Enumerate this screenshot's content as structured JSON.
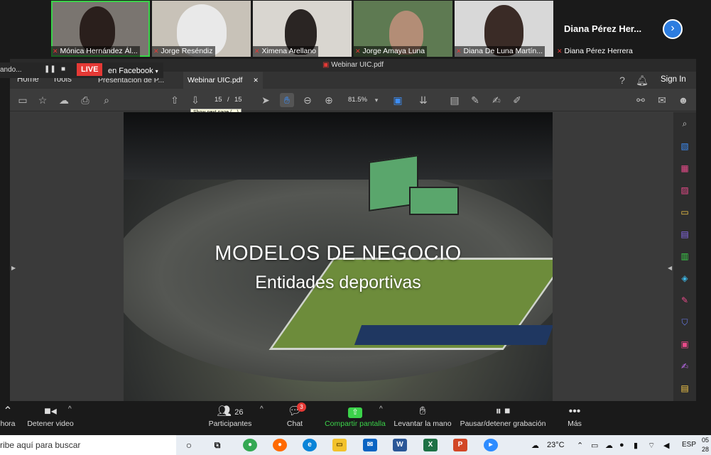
{
  "participants": [
    {
      "name": "Mónica Hernández Ál..."
    },
    {
      "name": "Jorge Reséndiz"
    },
    {
      "name": "Ximena Arellano"
    },
    {
      "name": "Jorge Amaya Luna"
    },
    {
      "name": "Diana De Luna Martín..."
    }
  ],
  "speaker_tile": {
    "big_name": "Diana Pérez Her...",
    "name": "Diana Pérez Herrera"
  },
  "live": {
    "recording_text": "ando...",
    "badge": "LIVE",
    "target": "en Facebook"
  },
  "acrobat": {
    "window_title": "Webinar UIC.pdf",
    "menu": {
      "home": "Home",
      "tools": "Tools"
    },
    "tabs": [
      {
        "label": "Presentación de P..."
      },
      {
        "label": "Webinar UIC.pdf"
      }
    ],
    "sign_in": "Sign In",
    "page_current": "15",
    "page_sep": "/",
    "page_total": "15",
    "zoom": "81.5%",
    "tooltip": "Show next page (→)"
  },
  "slide": {
    "title": "MODELOS DE NEGOCIO",
    "subtitle": "Entidades deportivas"
  },
  "zoom_controls": {
    "mute_label": "hora",
    "video_label": "Detener video",
    "participants_count": "26",
    "participants_label": "Participantes",
    "chat_badge": "3",
    "chat_label": "Chat",
    "share_label": "Compartir pantalla",
    "raise_hand_label": "Levantar la mano",
    "record_label": "Pausar/detener grabación",
    "more_label": "Más"
  },
  "taskbar": {
    "search_placeholder": "ribe aquí para buscar",
    "temperature": "23°C",
    "language": "ESP",
    "time": "05",
    "date": "28"
  }
}
